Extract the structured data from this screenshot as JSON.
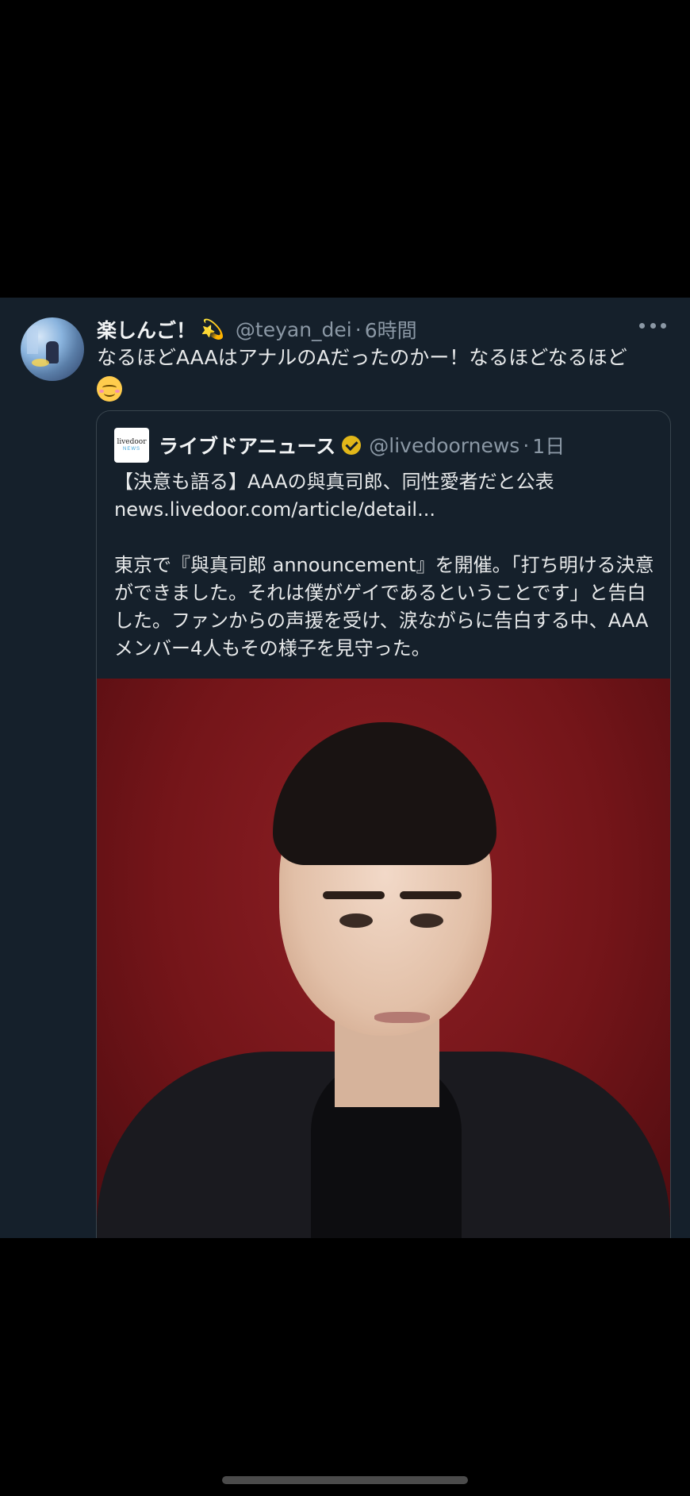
{
  "tweet": {
    "display_name": "楽しんご！",
    "name_emoji": "💫",
    "handle": "@teyan_dei",
    "separator": "·",
    "time": "6時間",
    "text": "なるほどAAAはアナルのAだったのかー！なるほどなるほど",
    "text_emoji": "☺️"
  },
  "quote": {
    "logo_line1": "livedoor",
    "logo_line2": "NEWS",
    "name": "ライブドアニュース",
    "handle": "@livedoornews",
    "separator": "·",
    "time": "1日",
    "headline": "【決意も語る】AAAの與真司郎、同性愛者だと公表",
    "link": "news.livedoor.com/article/detail...",
    "body": "東京で『與真司郎 announcement』を開催。「打ち明ける決意ができました。それは僕がゲイであるということです」と告白した。ファンからの声援を受け、涙ながらに告白する中、AAAメンバー4人もその様子を見守った。"
  },
  "colors": {
    "card_background": "#15202b",
    "text_primary": "#e7e9ea",
    "text_secondary": "#8b98a5",
    "border": "#38444d",
    "verified_badge": "#e2b719",
    "photo_background": "#7a1a1f"
  },
  "icons": [
    "more-icon",
    "verified-icon",
    "smile-icon"
  ]
}
